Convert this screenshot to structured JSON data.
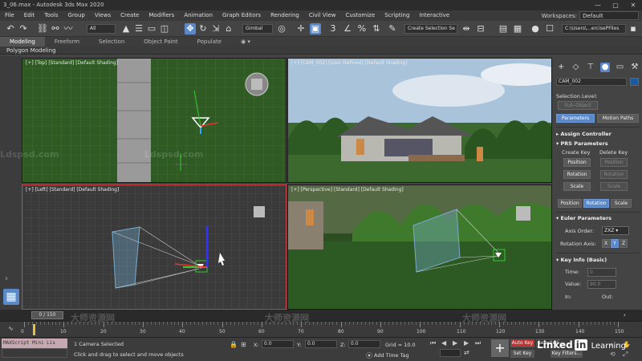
{
  "title_bar": {
    "title": "3_06.max - Autodesk 3ds Max 2020",
    "min": "—",
    "max": "▢",
    "close": "✕"
  },
  "menu": [
    "File",
    "Edit",
    "Tools",
    "Group",
    "Views",
    "Create",
    "Modifiers",
    "Animation",
    "Graph Editors",
    "Rendering",
    "Civil View",
    "Customize",
    "Scripting",
    "Interactive"
  ],
  "workspaces": {
    "label": "Workspaces:",
    "value": "Default"
  },
  "toolbar": {
    "filter_value": "All",
    "coord_value": "Gimbal",
    "selection_set": "Create Selection Se",
    "project_path": "C:\\Users\\...ercisePFiles"
  },
  "ribbon": {
    "tabs": [
      "Modeling",
      "Freeform",
      "Selection",
      "Object Paint",
      "Populate"
    ],
    "sub": "Polygon Modeling"
  },
  "viewports": {
    "top": {
      "label": "[+] [Top] [Standard] [Default Shading]"
    },
    "camera": {
      "label": "[+] [CAM_002] [User Defined] [Default Shading]"
    },
    "left": {
      "label": "[+] [Left] [Standard] [Default Shading]"
    },
    "perspective": {
      "label": "[+] [Perspective] [Standard] [Default Shading]"
    }
  },
  "command_panel": {
    "object_name": "CAM_002",
    "selection_level_label": "Selection Level:",
    "sub_object": "Sub-Object",
    "tabs": [
      "Parameters",
      "Motion Paths"
    ],
    "assign_controller": "Assign Controller",
    "prs_header": "PRS Parameters",
    "create_key": "Create Key",
    "delete_key": "Delete Key",
    "position": "Position",
    "rotation": "Rotation",
    "scale": "Scale",
    "bottom_tabs": [
      "Position",
      "Rotation",
      "Scale"
    ],
    "euler_header": "Euler Parameters",
    "axis_order_label": "Axis Order:",
    "axis_order_value": "ZXZ",
    "rotation_axis_label": "Rotation Axis:",
    "axes": [
      "X",
      "Y",
      "Z"
    ],
    "key_info_header": "Key Info (Basic)",
    "time_label": "Time:",
    "time_value": "0",
    "value_label": "Value:",
    "value_value": "90.0",
    "in_label": "In:",
    "out_label": "Out:"
  },
  "timeline": {
    "slider_text": "0 / 150",
    "ticks": [
      "0",
      "10",
      "20",
      "30",
      "40",
      "50",
      "60",
      "70",
      "80",
      "90",
      "100",
      "110",
      "120",
      "130",
      "140",
      "150"
    ]
  },
  "status": {
    "maxscript": "MAXScript Mini Lis",
    "selection": "1 Camera Selected",
    "prompt": "Click and drag to select and move objects",
    "x_label": "X:",
    "x_value": "0.0",
    "y_label": "Y:",
    "y_value": "0.0",
    "z_label": "Z:",
    "z_value": "0.0",
    "grid": "Grid = 10.0",
    "add_time_tag": "Add Time Tag",
    "auto_key": "Auto Key",
    "selected": "Selected",
    "set_key": "Set Key",
    "key_filters": "Key Filters..."
  },
  "watermarks": {
    "a": "Ldspsd.com",
    "b": "大师资源网"
  },
  "branding": {
    "linkedin": "Linked",
    "learning": "Learning"
  }
}
